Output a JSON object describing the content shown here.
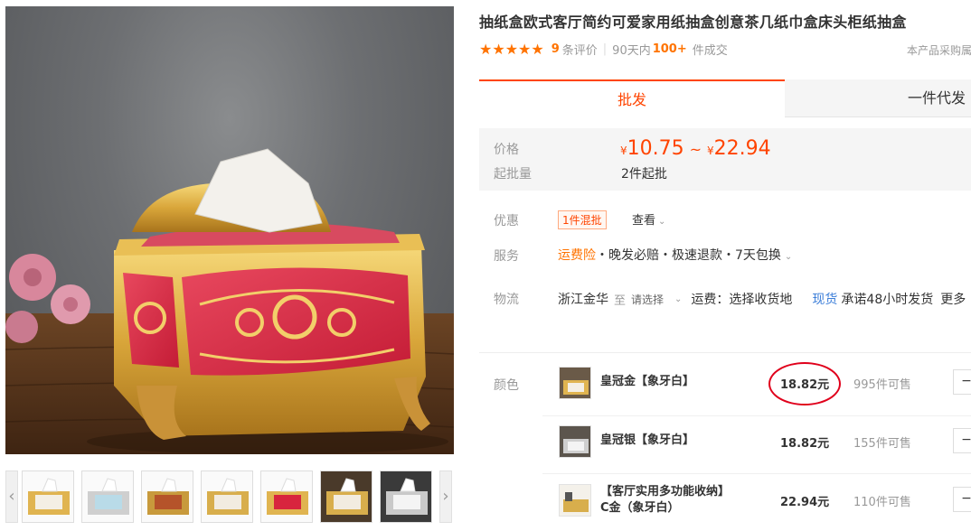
{
  "product": {
    "title": "抽纸盒欧式客厅简约可爱家用纸抽盒创意茶几纸巾盒床头柜纸抽盒"
  },
  "rating": {
    "stars": "★★★★★",
    "count": "9",
    "count_suffix": "条评价",
    "period": "90天内",
    "sold": "100+",
    "sold_suffix": "件成交",
    "purchase_note": "本产品采购属"
  },
  "tabs": {
    "wholesale": "批发",
    "dropship": "一件代发"
  },
  "price": {
    "label": "价格",
    "currency": "¥",
    "min": "10.75",
    "sep": "~",
    "max": "22.94",
    "moq_label": "起批量",
    "moq_value": "2件起批"
  },
  "promo": {
    "label": "优惠",
    "badge": "1件混批",
    "view": "查看"
  },
  "service": {
    "label": "服务",
    "insurance": "运费险",
    "rest": "・晚发必赔・极速退款・7天包换"
  },
  "logistics": {
    "label": "物流",
    "from": "浙江金华",
    "to": "至",
    "select": "请选择",
    "freight": "运费：选择收货地",
    "instock": "现货",
    "promise": "承诺48小时发货",
    "more": "更多"
  },
  "skus": {
    "label": "颜色",
    "items": [
      {
        "name_line1": "皇冠金【象牙白】",
        "name_line2": "",
        "price": "18.82元",
        "stock": "995件可售"
      },
      {
        "name_line1": "皇冠银【象牙白】",
        "name_line2": "",
        "price": "18.82元",
        "stock": "155件可售"
      },
      {
        "name_line1": "【客厅实用多功能收纳】",
        "name_line2": "C金（象牙白）",
        "price": "22.94元",
        "stock": "110件可售"
      }
    ],
    "minus": "−"
  },
  "thumbs": {
    "left_arrow": "‹",
    "right_arrow": "›"
  },
  "colors": {
    "accent": "#ff4400",
    "orange": "#ff7300",
    "gold": "#d9a63a",
    "red_enamel": "#d8243e"
  }
}
